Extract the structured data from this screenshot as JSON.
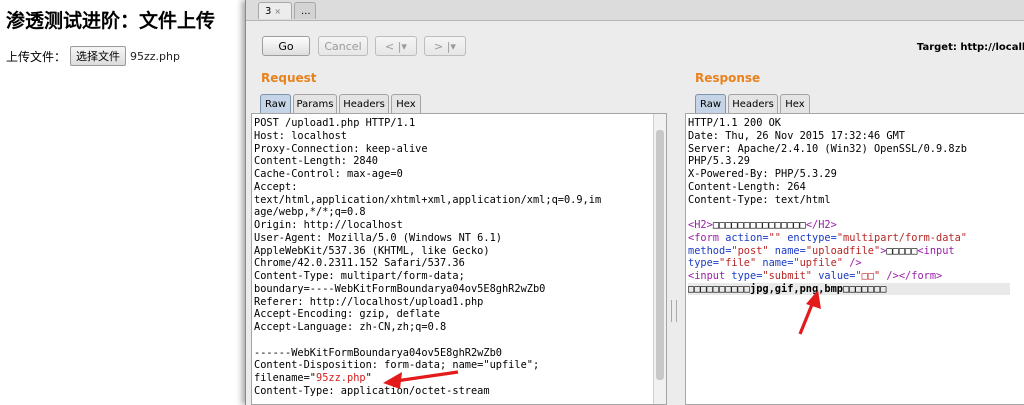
{
  "webpage": {
    "title": "渗透测试进阶：文件上传",
    "upload_label": "上传文件：",
    "file_button": "选择文件",
    "file_name": "95zz.php"
  },
  "burp": {
    "tabs": [
      {
        "label": "3",
        "close": "×"
      },
      {
        "label": "..."
      }
    ],
    "toolbar": {
      "go": "Go",
      "cancel": "Cancel",
      "back": "< |▾",
      "forward": "> |▾",
      "target": "Target: http://localh"
    },
    "request": {
      "title": "Request",
      "tabs": [
        "Raw",
        "Params",
        "Headers",
        "Hex"
      ],
      "lines_top": [
        "POST /upload1.php HTTP/1.1",
        "Host: localhost",
        "Proxy-Connection: keep-alive",
        "Content-Length: 2840",
        "Cache-Control: max-age=0",
        "Accept:",
        "text/html,application/xhtml+xml,application/xml;q=0.9,im",
        "age/webp,*/*;q=0.8",
        "Origin: http://localhost",
        "User-Agent: Mozilla/5.0 (Windows NT 6.1)",
        "AppleWebKit/537.36 (KHTML, like Gecko)",
        "Chrome/42.0.2311.152 Safari/537.36",
        "Content-Type: multipart/form-data;",
        "boundary=----WebKitFormBoundarya04ov5E8ghR2wZb0",
        "Referer: http://localhost/upload1.php",
        "Accept-Encoding: gzip, deflate",
        "Accept-Language: zh-CN,zh;q=0.8",
        "",
        "------WebKitFormBoundarya04ov5E8ghR2wZb0",
        "Content-Disposition: form-data; name=\"upfile\";"
      ],
      "filename_prefix": "filename=\"",
      "filename_value": "95zz.php",
      "filename_suffix": "\"",
      "last_line": "Content-Type: application/octet-stream"
    },
    "response": {
      "title": "Response",
      "tabs": [
        "Raw",
        "Headers",
        "Hex"
      ],
      "headers": [
        "HTTP/1.1 200 OK",
        "Date: Thu, 26 Nov 2015 17:32:46 GMT",
        "Server: Apache/2.4.10 (Win32) OpenSSL/0.9.8zb",
        "PHP/5.3.29",
        "X-Powered-By: PHP/5.3.29",
        "Content-Length: 264",
        "Content-Type: text/html"
      ],
      "body": {
        "h2_open": "<H2>",
        "h2_text": "□□□□□□□□□□□□□□□",
        "h2_close": "</H2>",
        "form_open": "<form",
        "form_action_attr": " action=",
        "form_action_val": "\"\"",
        "form_enctype_attr": " enctype=",
        "form_enctype_val": "\"multipart/form-data\"",
        "form_method_attr": "method=",
        "form_method_val": "\"post\"",
        "form_name_attr": " name=",
        "form_name_val": "\"uploadfile\"",
        "form_close_bracket": ">",
        "form_text": "□□□□□",
        "input1_open": "<input",
        "input1_type_attr": "type=",
        "input1_type_val": "\"file\"",
        "input1_name_attr": " name=",
        "input1_name_val": "\"upfile\"",
        "input1_close": " />",
        "input2_open": "<input",
        "input2_type_attr": " type=",
        "input2_type_val": "\"submit\"",
        "input2_value_attr": " value=",
        "input2_value_val": "\"□□\"",
        "input2_close": " />",
        "form_end": "</form>",
        "allowed_prefix": "□□□□□□□□□□",
        "allowed_types": "jpg,gif,png,bmp",
        "allowed_suffix": "□□□□□□□"
      }
    }
  }
}
